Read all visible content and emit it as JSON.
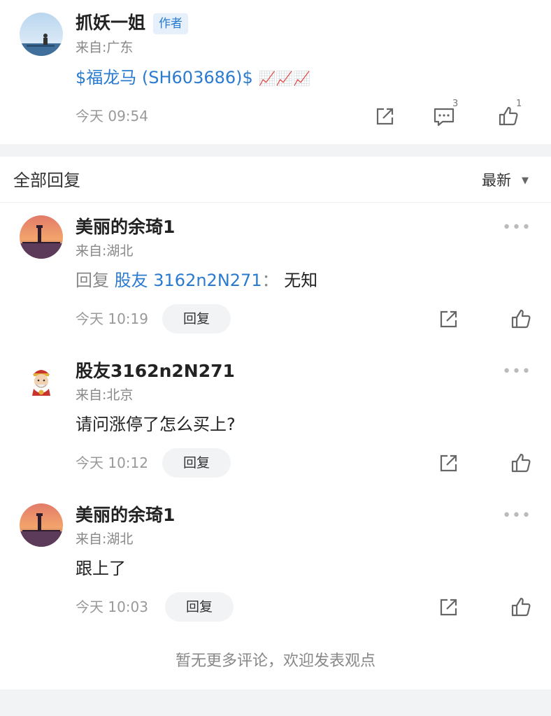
{
  "post": {
    "author": "抓妖一姐",
    "author_badge": "作者",
    "location": "来自:广东",
    "content_link": "$福龙马 (SH603686)$",
    "emoji": "📈📈📈",
    "time": "今天 09:54",
    "comment_count": "3",
    "like_count": "1"
  },
  "replies_header": {
    "title": "全部回复",
    "sort": "最新",
    "caret": "▼"
  },
  "replies": [
    {
      "author": "美丽的余琦1",
      "location": "来自:湖北",
      "reply_prefix": "回复",
      "reply_to": "股友 3162n2N271",
      "reply_sep": "：",
      "content": "无知",
      "time": "今天 10:19",
      "reply_button": "回复"
    },
    {
      "author": "股友3162n2N271",
      "location": "来自:北京",
      "content": "请问涨停了怎么买上?",
      "time": "今天 10:12",
      "reply_button": "回复"
    },
    {
      "author": "美丽的余琦1",
      "location": "来自:湖北",
      "content": "跟上了",
      "time": "今天 10:03",
      "reply_button": "回复"
    }
  ],
  "more_icon": "•••",
  "end_note": "暂无更多评论，欢迎发表观点",
  "colors": {
    "link": "#2a7bd0",
    "background": "#f2f3f5",
    "muted": "#888888"
  }
}
